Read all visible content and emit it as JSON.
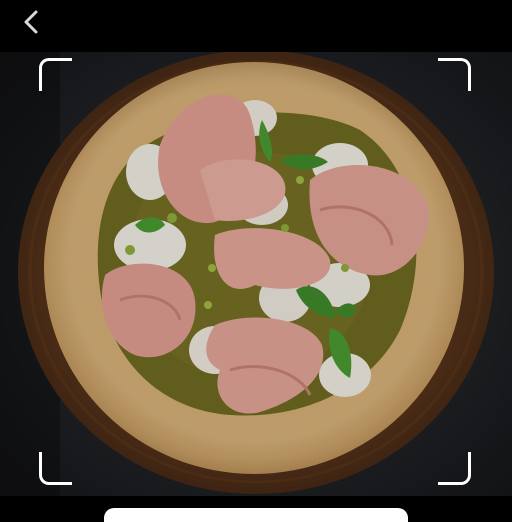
{
  "toolbar": {
    "back_icon": "chevron-left-icon",
    "back_color": "#ffffff"
  },
  "photo": {
    "subject": "pizza-photo",
    "scan_frame_color": "#ffffff"
  },
  "colors": {
    "background": "#000000",
    "crust": "#d9b27a",
    "pesto": "#6f6a22",
    "mortadella": "#e7a79a",
    "burrata": "#f1ede4",
    "basil": "#3f8a2a"
  }
}
